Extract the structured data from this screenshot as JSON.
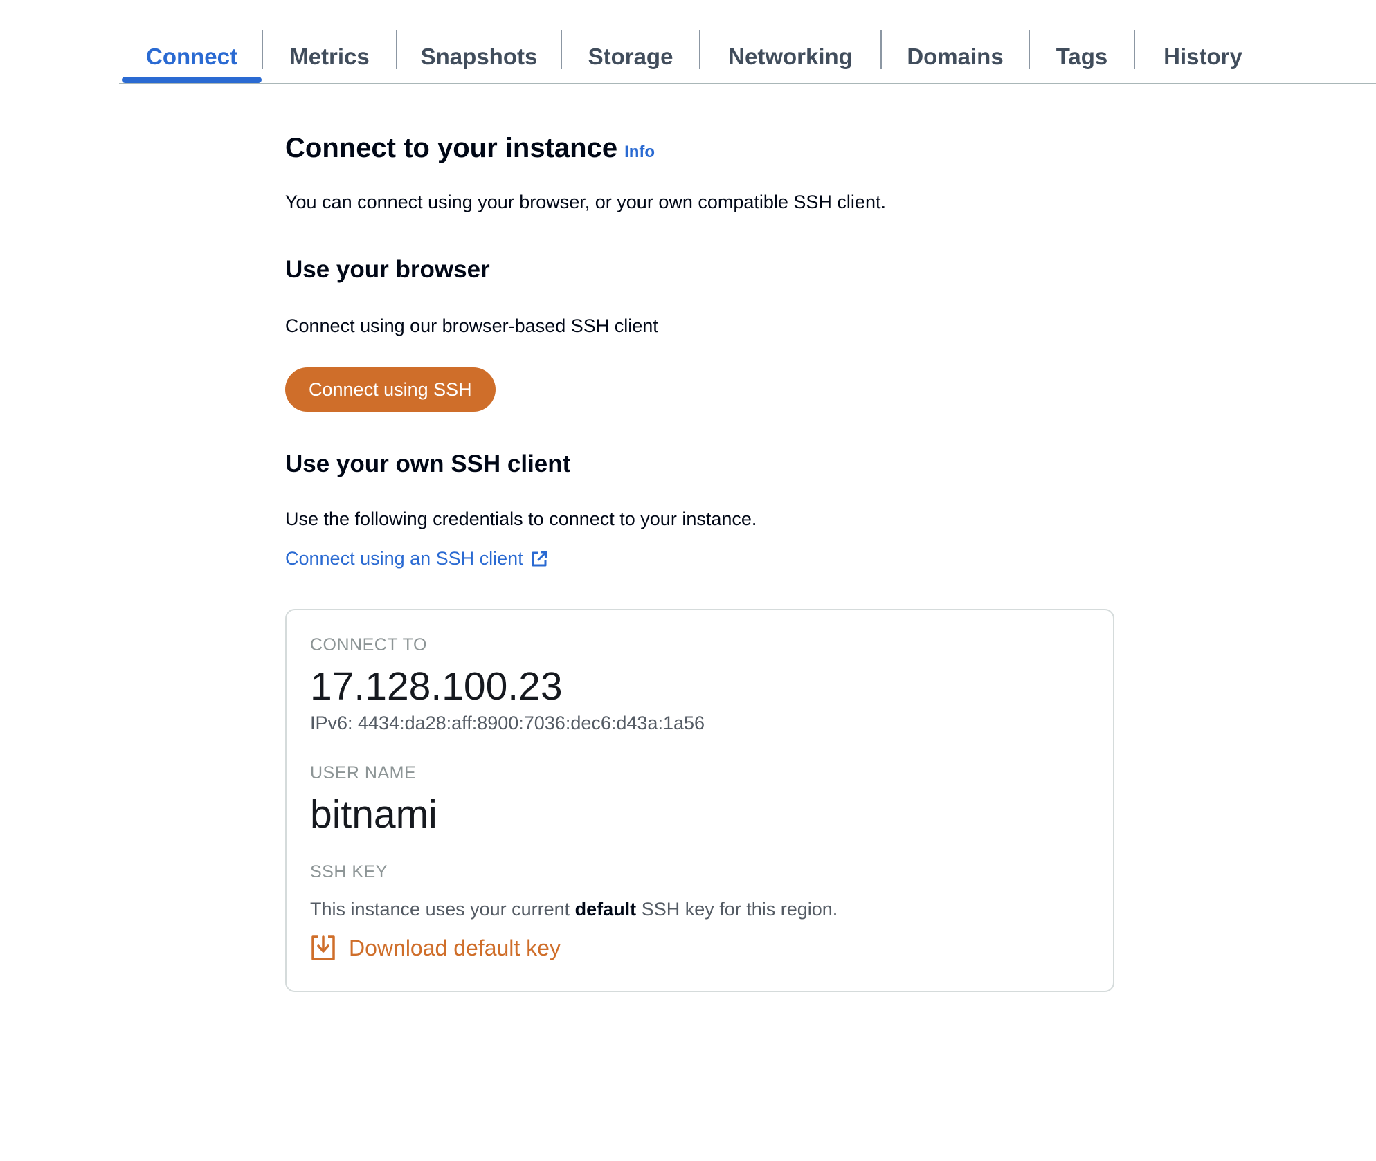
{
  "tabs": [
    {
      "label": "Connect",
      "active": true
    },
    {
      "label": "Metrics",
      "active": false
    },
    {
      "label": "Snapshots",
      "active": false
    },
    {
      "label": "Storage",
      "active": false
    },
    {
      "label": "Networking",
      "active": false
    },
    {
      "label": "Domains",
      "active": false
    },
    {
      "label": "Tags",
      "active": false
    },
    {
      "label": "History",
      "active": false
    }
  ],
  "page": {
    "title": "Connect to your instance",
    "info_link": "Info",
    "intro": "You can connect using your browser, or your own compatible SSH client."
  },
  "browser_section": {
    "heading": "Use your browser",
    "description": "Connect using our browser-based SSH client",
    "button_label": "Connect using SSH"
  },
  "client_section": {
    "heading": "Use your own SSH client",
    "description": "Use the following credentials to connect to your instance.",
    "link_label": "Connect using an SSH client",
    "link_icon": "external-link-icon"
  },
  "credentials": {
    "connect_to_label": "CONNECT TO",
    "ip_address": "17.128.100.23",
    "ipv6": "IPv6: 4434:da28:aff:8900:7036:dec6:d43a:1a56",
    "user_name_label": "USER NAME",
    "user_name": "bitnami",
    "ssh_key_label": "SSH KEY",
    "ssh_key_text_before": "This instance uses your current ",
    "ssh_key_text_bold": "default",
    "ssh_key_text_after": " SSH key for this region.",
    "download_label": "Download default key",
    "download_icon": "download-icon"
  },
  "colors": {
    "accent_blue": "#2a6ad2",
    "accent_orange": "#cf6e2a",
    "tab_text": "#414d5c",
    "muted_label": "#8d9596"
  }
}
